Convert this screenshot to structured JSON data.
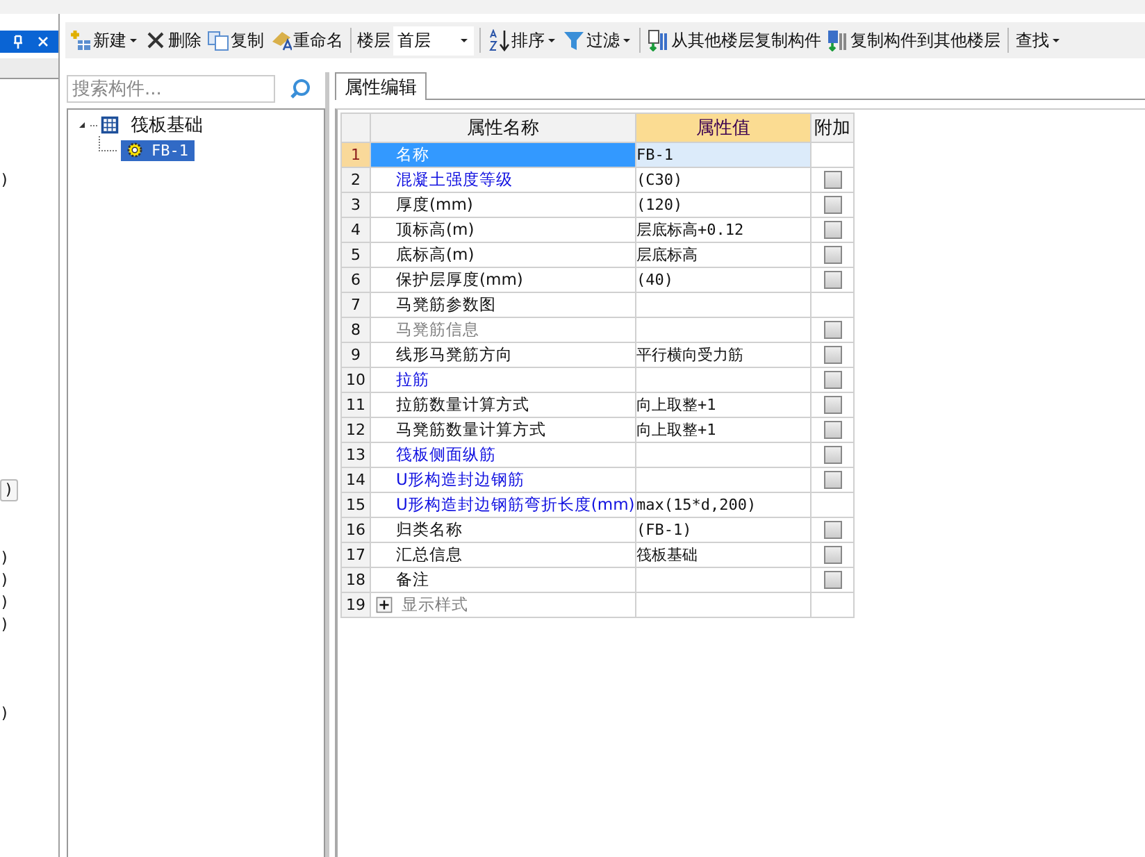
{
  "side_fragments": [
    {
      "text": ")",
      "boxed": false
    },
    {
      "text": ")",
      "boxed": true
    },
    {
      "text": ")",
      "boxed": false
    },
    {
      "text": ")",
      "boxed": false
    },
    {
      "text": ")",
      "boxed": false
    },
    {
      "text": ")",
      "boxed": false
    },
    {
      "text": ")",
      "boxed": false
    }
  ],
  "toolbar": [
    {
      "kind": "button",
      "label": "新建",
      "menu": true
    },
    {
      "kind": "button",
      "label": "删除",
      "menu": false
    },
    {
      "kind": "button",
      "label": "复制",
      "menu": false
    },
    {
      "kind": "button",
      "label": "重命名",
      "menu": false
    },
    {
      "kind": "separator"
    },
    {
      "kind": "label",
      "label": "楼层"
    },
    {
      "kind": "dropdown",
      "value": "首层"
    },
    {
      "kind": "separator"
    },
    {
      "kind": "button",
      "label": "排序",
      "menu": true
    },
    {
      "kind": "button",
      "label": "过滤",
      "menu": true
    },
    {
      "kind": "separator"
    },
    {
      "kind": "button",
      "label": "从其他楼层复制构件",
      "menu": false
    },
    {
      "kind": "button",
      "label": "复制构件到其他楼层",
      "menu": false
    },
    {
      "kind": "separator"
    },
    {
      "kind": "button",
      "label": "查找",
      "menu": true
    }
  ],
  "search": {
    "placeholder": "搜索构件..."
  },
  "tree": [
    {
      "label": "筏板基础",
      "expanded": true,
      "selected": false,
      "children": [
        {
          "label": "FB-1",
          "selected": true
        }
      ]
    }
  ],
  "tabs": [
    {
      "label": "属性编辑",
      "selected": true
    }
  ],
  "table": {
    "columns": [
      "属性名称",
      "属性值",
      "附加"
    ],
    "rows": [
      {
        "index": "1",
        "name": "名称",
        "value": "FB-1",
        "color": "#ffffff",
        "selected": true,
        "kind": "none"
      },
      {
        "index": "2",
        "name": "混凝土强度等级",
        "value": "(C30)",
        "color": "#1010e0",
        "selected": false,
        "kind": "checkbox",
        "checked": false
      },
      {
        "index": "3",
        "name": "厚度(mm)",
        "value": "(120)",
        "color": "#111111",
        "selected": false,
        "kind": "checkbox",
        "checked": false
      },
      {
        "index": "4",
        "name": "顶标高(m)",
        "value": "层底标高+0.12",
        "color": "#111111",
        "selected": false,
        "kind": "checkbox",
        "checked": false
      },
      {
        "index": "5",
        "name": "底标高(m)",
        "value": "层底标高",
        "color": "#111111",
        "selected": false,
        "kind": "checkbox",
        "checked": false
      },
      {
        "index": "6",
        "name": "保护层厚度(mm)",
        "value": "(40)",
        "color": "#111111",
        "selected": false,
        "kind": "checkbox",
        "checked": false
      },
      {
        "index": "7",
        "name": "马凳筋参数图",
        "color": "#111111",
        "selected": false,
        "kind": "none"
      },
      {
        "index": "8",
        "name": "马凳筋信息",
        "color": "#808080",
        "selected": false,
        "kind": "checkbox",
        "checked": false
      },
      {
        "index": "9",
        "name": "线形马凳筋方向",
        "value": "平行横向受力筋",
        "color": "#111111",
        "selected": false,
        "kind": "checkbox",
        "checked": false
      },
      {
        "index": "10",
        "name": "拉筋",
        "color": "#1010e0",
        "selected": false,
        "kind": "checkbox",
        "checked": false
      },
      {
        "index": "11",
        "name": "拉筋数量计算方式",
        "value": "向上取整+1",
        "color": "#111111",
        "selected": false,
        "kind": "checkbox",
        "checked": false
      },
      {
        "index": "12",
        "name": "马凳筋数量计算方式",
        "value": "向上取整+1",
        "color": "#111111",
        "selected": false,
        "kind": "checkbox",
        "checked": false
      },
      {
        "index": "13",
        "name": "筏板侧面纵筋",
        "color": "#1010e0",
        "selected": false,
        "kind": "checkbox",
        "checked": false
      },
      {
        "index": "14",
        "name": "U形构造封边钢筋",
        "color": "#1010e0",
        "selected": false,
        "kind": "checkbox",
        "checked": false
      },
      {
        "index": "15",
        "name": "U形构造封边钢筋弯折长度(mm)",
        "value": "max(15*d,200)",
        "color": "#1010e0",
        "selected": false,
        "kind": "none"
      },
      {
        "index": "16",
        "name": "归类名称",
        "value": "(FB-1)",
        "color": "#111111",
        "selected": false,
        "kind": "checkbox",
        "checked": false
      },
      {
        "index": "17",
        "name": "汇总信息",
        "value": "筏板基础",
        "color": "#111111",
        "selected": false,
        "kind": "checkbox",
        "checked": false
      },
      {
        "index": "18",
        "name": "备注",
        "color": "#111111",
        "selected": false,
        "kind": "checkbox",
        "checked": false
      },
      {
        "index": "19",
        "name": "显示样式",
        "color": "#808080",
        "selected": false,
        "kind": "group",
        "expanded": false
      }
    ]
  }
}
